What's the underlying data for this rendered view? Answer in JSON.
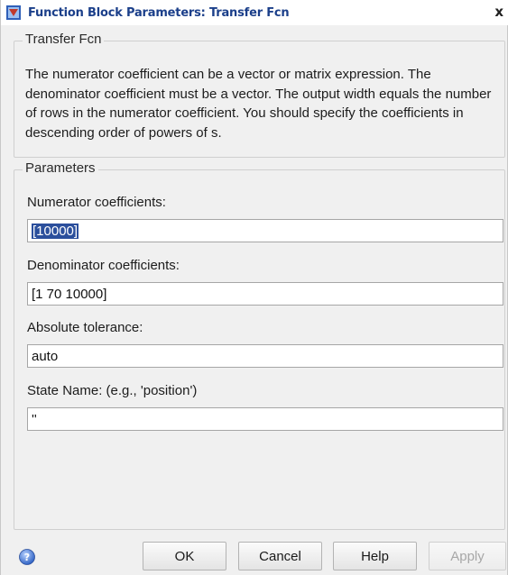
{
  "window": {
    "title": "Function Block Parameters: Transfer Fcn",
    "close_glyph": "x"
  },
  "block": {
    "group_label": "Transfer Fcn",
    "description": "The numerator coefficient can be a vector or matrix expression. The denominator coefficient must be a vector. The output width equals the number of rows in the numerator coefficient. You should specify the coefficients in descending order of powers of s."
  },
  "parameters": {
    "group_label": "Parameters",
    "numerator": {
      "label": "Numerator coefficients:",
      "value": "[10000]"
    },
    "denominator": {
      "label": "Denominator coefficients:",
      "value": "[1 70 10000]"
    },
    "abs_tol": {
      "label": "Absolute tolerance:",
      "value": "auto"
    },
    "state_name": {
      "label": "State Name: (e.g., 'position')",
      "value": "''"
    }
  },
  "buttons": {
    "ok": "OK",
    "cancel": "Cancel",
    "help": "Help",
    "apply": "Apply"
  },
  "icons": {
    "app": "simulink-block-icon",
    "help": "help-icon"
  },
  "colors": {
    "title_text": "#1b3f8a",
    "selection": "#2b4f9c"
  }
}
